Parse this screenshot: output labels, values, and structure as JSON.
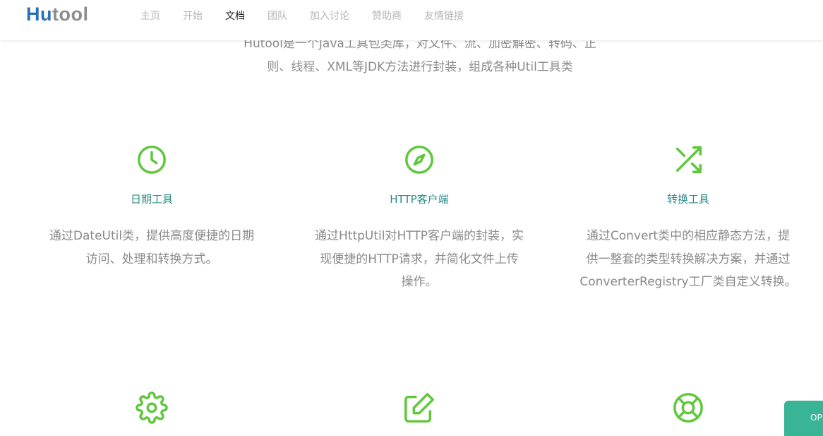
{
  "header": {
    "logo": {
      "part1": "Hu",
      "part2": "tool"
    },
    "nav": [
      {
        "label": "主页",
        "active": false
      },
      {
        "label": "开始",
        "active": false
      },
      {
        "label": "文档",
        "active": true
      },
      {
        "label": "团队",
        "active": false
      },
      {
        "label": "加入讨论",
        "active": false
      },
      {
        "label": "赞助商",
        "active": false
      },
      {
        "label": "友情链接",
        "active": false
      }
    ]
  },
  "intro": {
    "line1": "Hutool是一个Java工具包类库，对文件、流、加密解密、转码、正",
    "line2": "则、线程、XML等JDK方法进行封装，组成各种Util工具类"
  },
  "features": [
    {
      "icon": "clock-icon",
      "title": "日期工具",
      "desc_lines": [
        "通过DateUtil类，提供高度便捷的日期",
        "访问、处理和转换方式。"
      ]
    },
    {
      "icon": "compass-icon",
      "title": "HTTP客户端",
      "desc_lines": [
        "通过HttpUtil对HTTP客户端的封装，实",
        "现便捷的HTTP请求，并简化文件上传",
        "操作。"
      ]
    },
    {
      "icon": "shuffle-icon",
      "title": "转换工具",
      "desc_lines": [
        "通过Convert类中的相应静态方法，提",
        "供一整套的类型转换解决方案，并通过",
        "ConverterRegistry工厂类自定义转换。"
      ]
    },
    {
      "icon": "gear-icon"
    },
    {
      "icon": "edit-icon"
    },
    {
      "icon": "lifebuoy-icon"
    }
  ],
  "float_tab": {
    "label": "OP"
  },
  "colors": {
    "accent_green": "#5ec73a",
    "title_teal": "#2b8a84",
    "logo_blue": "#2b6fb6",
    "logo_gray": "#8d8d8d",
    "float_tab_bg": "#39b494",
    "text_gray": "#8a8a8a"
  }
}
